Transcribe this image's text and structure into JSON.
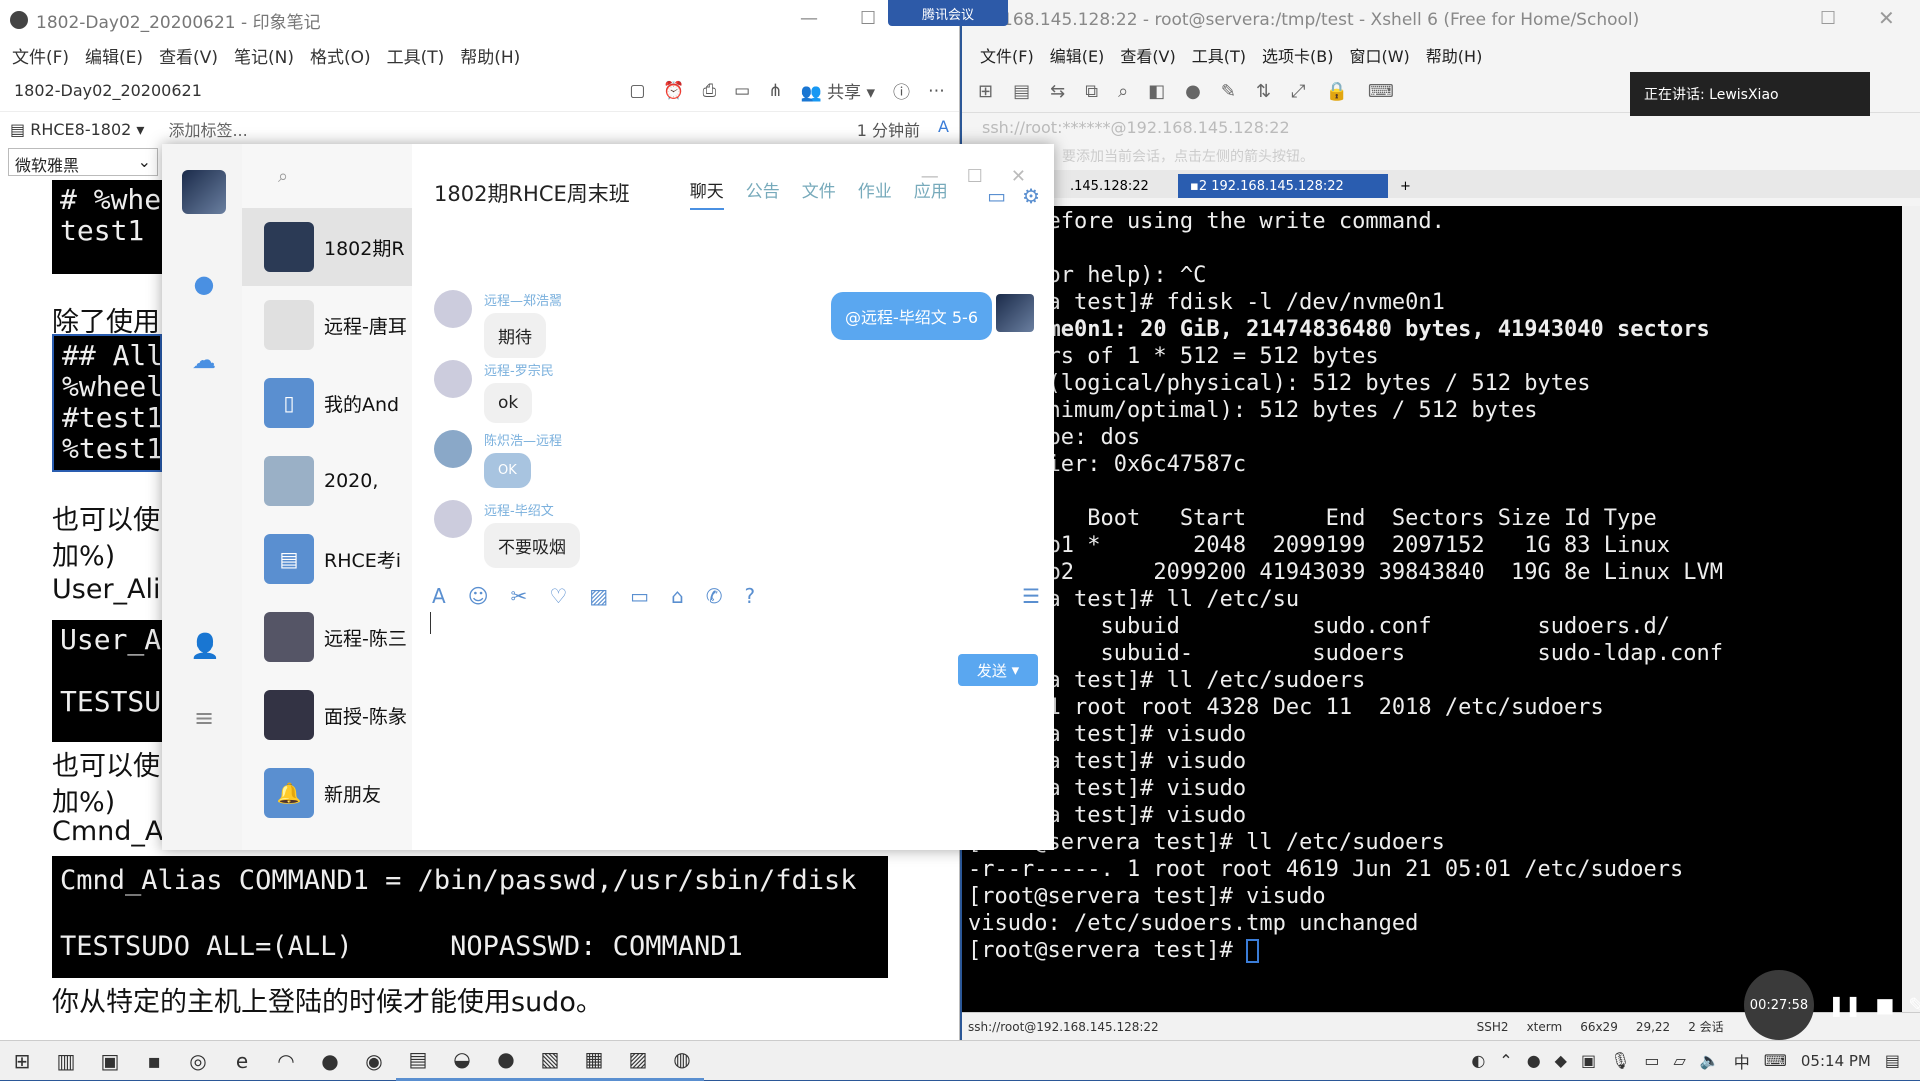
{
  "evernote": {
    "title": "1802-Day02_20200621 - 印象笔记",
    "menu": [
      "文件(F)",
      "编辑(E)",
      "查看(V)",
      "笔记(N)",
      "格式(O)",
      "工具(T)",
      "帮助(H)"
    ],
    "note_title": "1802-Day02_20200621",
    "share_label": "共享",
    "notebook": "RHCE8-1802",
    "add_tag": "添加标签...",
    "modified": "1 分钟前",
    "font": "微软雅黑",
    "blocks": {
      "b1": "# %whe\ntest1",
      "b2": "## All\n%wheel\n#test1\n%test1",
      "b3": "User_A\n\nTESTSU",
      "b4": "Cmnd_Alias COMMAND1 = /bin/passwd,/usr/sbin/fdisk\n\nTESTSUDO ALL=(ALL)      NOPASSWD: COMMAND1"
    },
    "texts": {
      "t1": "除了使用",
      "t2": "也可以使",
      "t3": "加%)",
      "t4": "User_Alia",
      "t5": "也可以使",
      "t6": "加%)",
      "t7": "Cmnd_A",
      "t8": "你从特定的主机上登陆的时候才能使用sudo。"
    }
  },
  "xshell": {
    "title": "168.145.128:22 - root@servera:/tmp/test - Xshell 6 (Free for Home/School)",
    "menu": [
      "文件(F)",
      "编辑(E)",
      "查看(V)",
      "工具(T)",
      "选项卡(B)",
      "窗口(W)",
      "帮助(H)"
    ],
    "speaking": "正在讲话: LewisXiao",
    "address": "ssh://root:******@192.168.145.128:22",
    "hint": "要添加当前会话，点击左侧的箭头按钮。",
    "tabs": [
      ".145.128:22",
      "2 192.168.145.128:22"
    ],
    "terminal_lines": [
      "eful before using the write command.",
      "",
      "d (m for help): ^C",
      "servera test]# fdisk -l /dev/nvme0n1",
      "dev/nvme0n1: 20 GiB, 21474836480 bytes, 41943040 sectors",
      " sectors of 1 * 512 = 512 bytes",
      " size (logical/physical): 512 bytes / 512 bytes",
      "ze (minimum/optimal): 512 bytes / 512 bytes",
      "bel type: dos",
      "dentifier: 0x6c47587c",
      "",
      "         Boot   Start      End  Sectors Size Id Type",
      "vme0n1p1 *       2048  2099199  2097152   1G 83 Linux",
      "vme0n1p2      2099200 41943039 39843840  19G 8e Linux LVM",
      "servera test]# ll /etc/su",
      "          subuid          sudo.conf        sudoers.d/",
      "-         subuid-         sudoers          sudo-ldap.conf",
      "servera test]# ll /etc/sudoers",
      "----. 1 root root 4328 Dec 11  2018 /etc/sudoers",
      "servera test]# visudo",
      "servera test]# visudo",
      "servera test]# visudo",
      "servera test]# visudo",
      "[root@servera test]# ll /etc/sudoers",
      "-r--r-----. 1 root root 4619 Jun 21 05:01 /etc/sudoers",
      "[root@servera test]# visudo",
      "visudo: /etc/sudoers.tmp unchanged",
      "[root@servera test]# "
    ],
    "status": {
      "conn": "ssh://root@192.168.145.128:22",
      "proto": "SSH2",
      "term": "xterm",
      "size": "66x29",
      "pos": "29,22",
      "sessions": "2 会话"
    }
  },
  "meeting": {
    "banner": "腾讯会议",
    "timer": "00:27:58"
  },
  "qq": {
    "chat_title": "1802期RHCE周末班",
    "tabs": [
      "聊天",
      "公告",
      "文件",
      "作业",
      "应用"
    ],
    "contacts": [
      "1802期R",
      "远程-唐耳",
      "我的And",
      "2020,",
      "RHCE考i",
      "远程-陈三",
      "面授-陈彖",
      "新朋友"
    ],
    "outgoing": "@远程-毕绍文 5-6",
    "messages": [
      {
        "name": "远程—郑浩翯",
        "text": "期待"
      },
      {
        "name": "远程-罗宗民",
        "text": "ok"
      },
      {
        "name": "陈炽浩—远程",
        "text": "OK"
      },
      {
        "name": "远程-毕绍文",
        "text": "不要吸烟"
      }
    ],
    "send": "发送"
  },
  "taskbar": {
    "ime": "中",
    "time": "05:14 PM"
  }
}
